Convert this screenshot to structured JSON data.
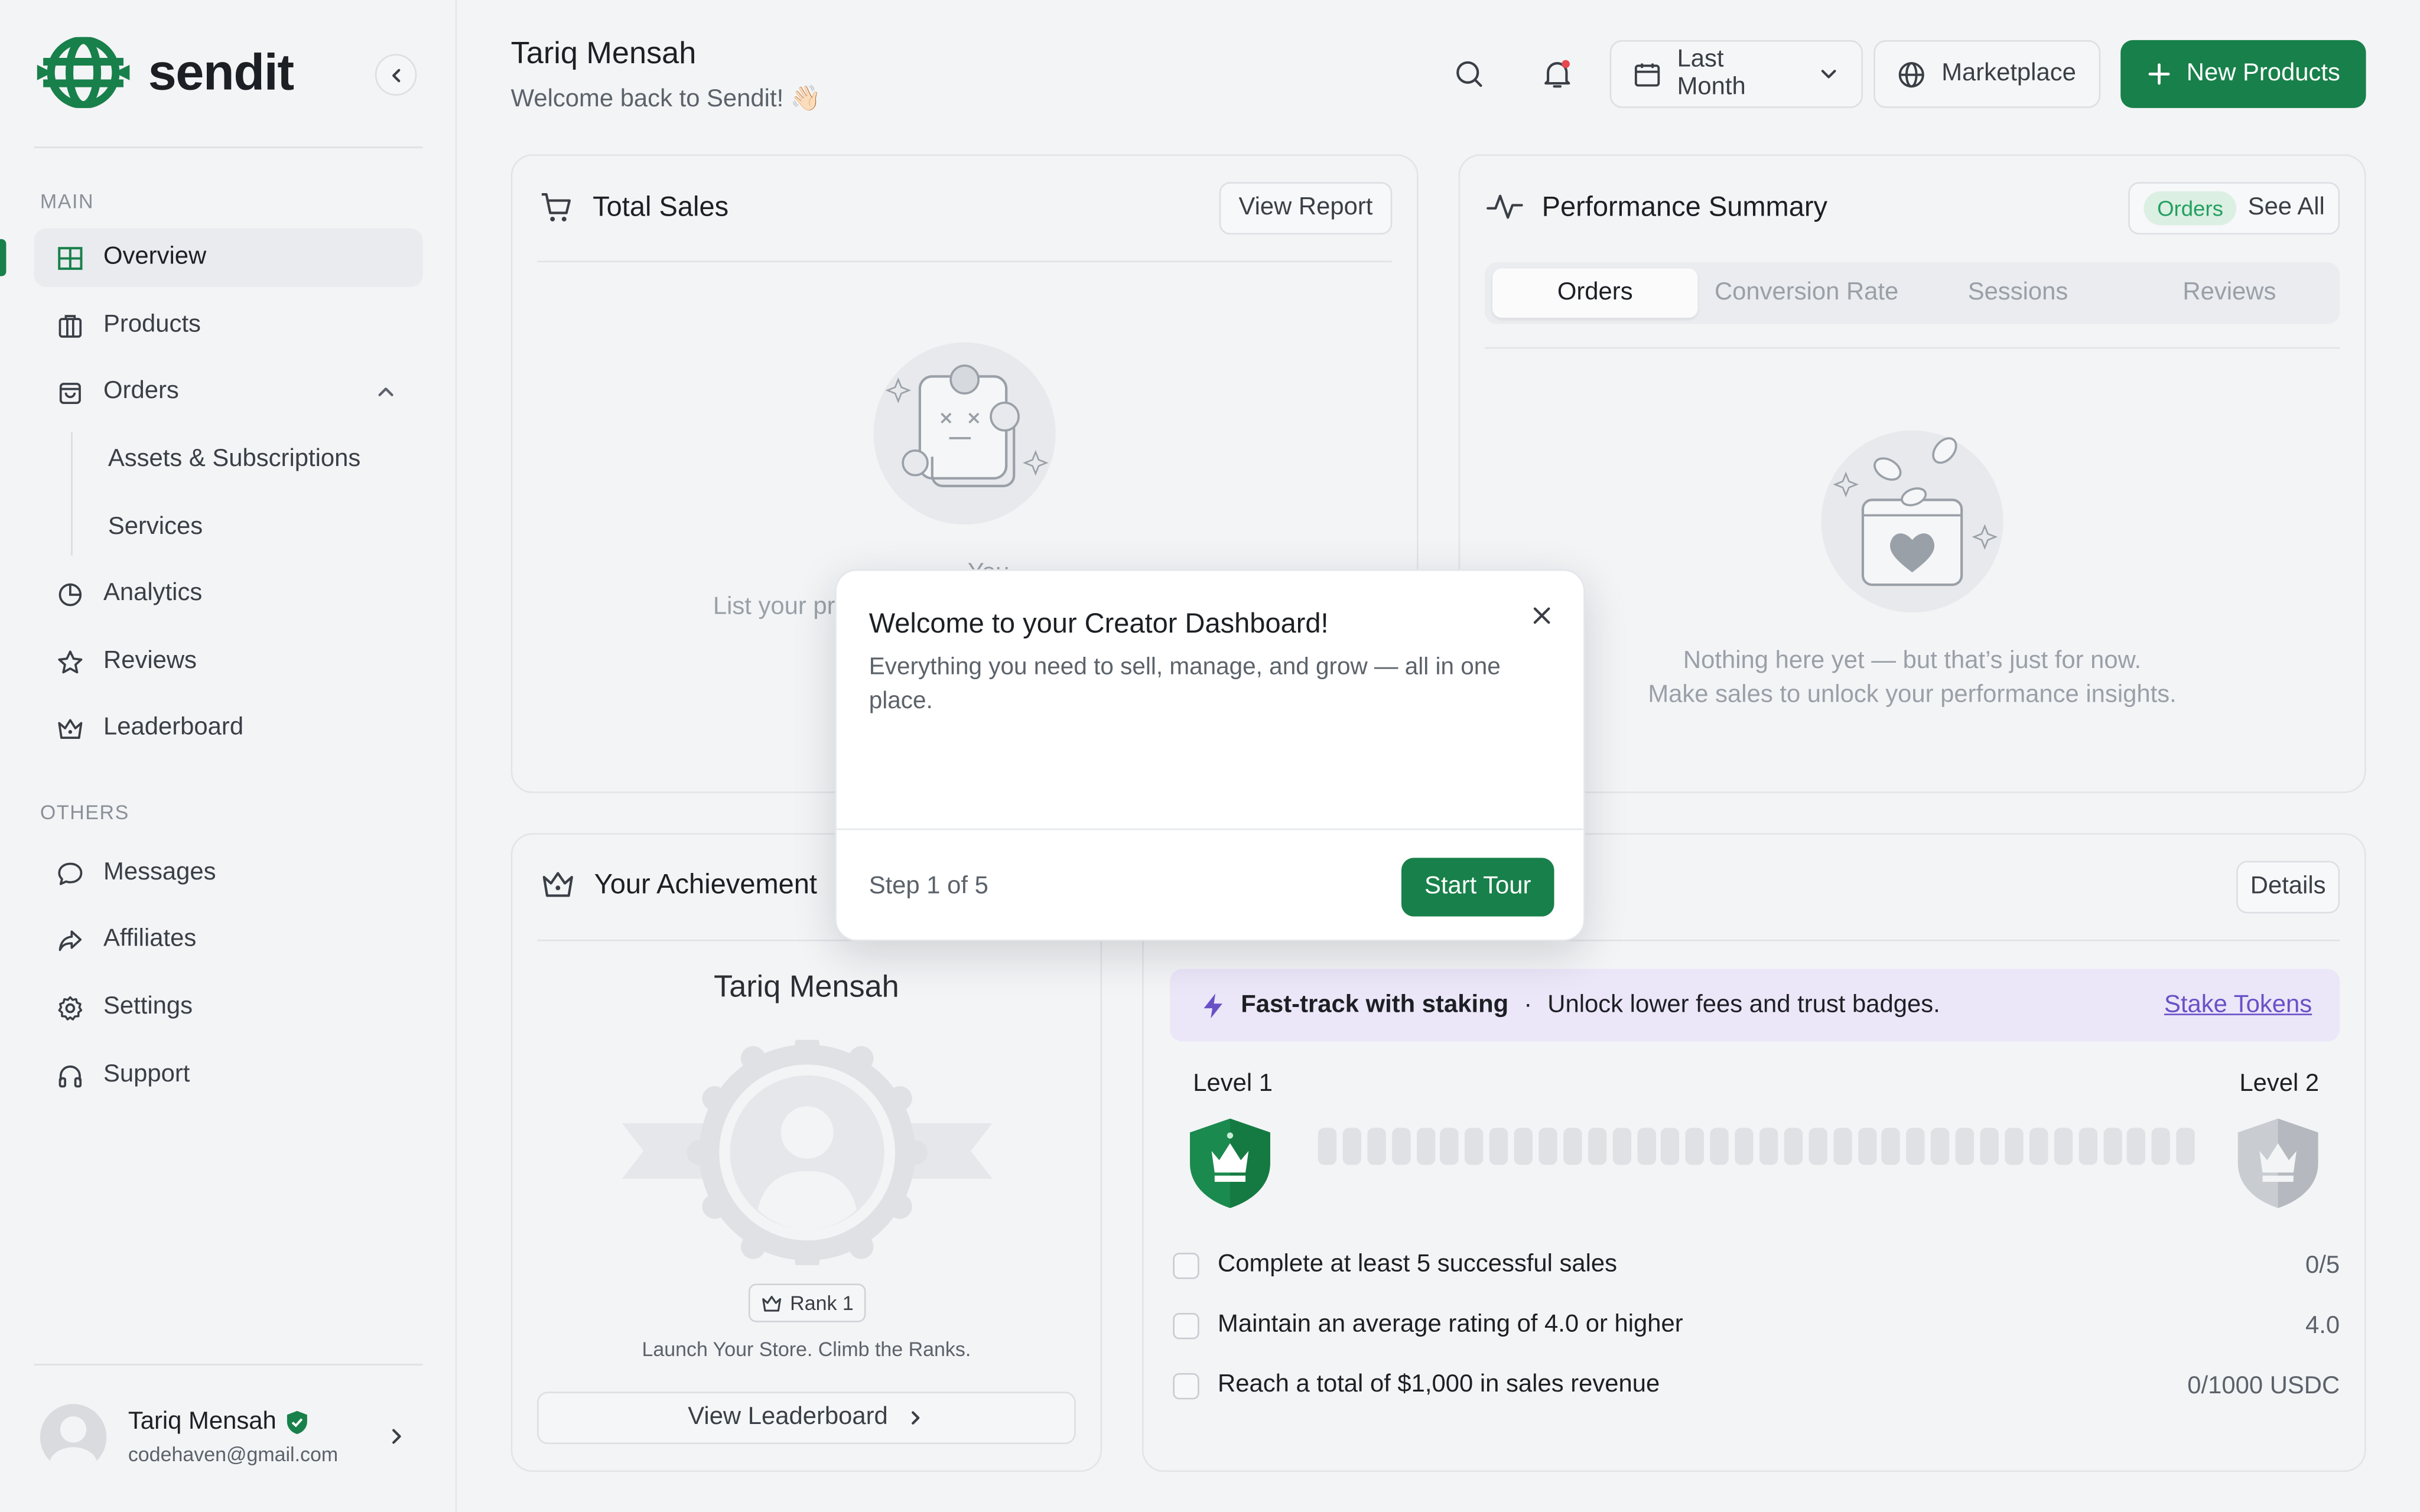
{
  "brand": {
    "name": "sendit"
  },
  "colors": {
    "accent": "#18804a",
    "stake_bg": "#ebe6f8",
    "stake_link": "#6a50c7",
    "badge_green": "#23a061"
  },
  "sidebar": {
    "main_label": "MAIN",
    "others_label": "OTHERS",
    "items": [
      {
        "label": "Overview",
        "icon": "grid-icon",
        "active": true
      },
      {
        "label": "Products",
        "icon": "box-icon"
      },
      {
        "label": "Orders",
        "icon": "bag-icon",
        "expanded": true
      },
      {
        "label": "Analytics",
        "icon": "pie-chart-icon"
      },
      {
        "label": "Reviews",
        "icon": "star-icon"
      },
      {
        "label": "Leaderboard",
        "icon": "crown-icon"
      }
    ],
    "sub_items": [
      "Assets & Subscriptions",
      "Services"
    ],
    "other_items": [
      {
        "label": "Messages",
        "icon": "chat-icon"
      },
      {
        "label": "Affiliates",
        "icon": "share-icon"
      },
      {
        "label": "Settings",
        "icon": "gear-icon"
      },
      {
        "label": "Support",
        "icon": "headphones-icon"
      }
    ],
    "profile": {
      "name": "Tariq Mensah",
      "email": "codehaven@gmail.com"
    }
  },
  "header": {
    "name": "Tariq Mensah",
    "welcome": "Welcome back to Sendit! 👋🏻",
    "period": "Last Month",
    "marketplace": "Marketplace",
    "new_products": "New Products"
  },
  "total_sales": {
    "title": "Total Sales",
    "view_report": "View Report",
    "empty_line1": "You",
    "empty_line2": "List your pr"
  },
  "performance": {
    "title": "Performance Summary",
    "badge": "Orders",
    "see_all": "See All",
    "tabs": [
      "Orders",
      "Conversion Rate",
      "Sessions",
      "Reviews"
    ],
    "empty_line1": "Nothing here yet — but that’s just for now.",
    "empty_line2": "Make sales to unlock your performance insights."
  },
  "achievement": {
    "title": "Your Achievement",
    "name": "Tariq Mensah",
    "rank": "Rank 1",
    "tagline": "Launch Your Store. Climb the Ranks.",
    "leaderboard_btn": "View Leaderboard"
  },
  "levels": {
    "details": "Details",
    "stake_title": "Fast-track with staking",
    "stake_sep": "·",
    "stake_desc": "Unlock lower fees and trust badges.",
    "stake_link": "Stake Tokens",
    "level_from": "Level 1",
    "level_to": "Level 2",
    "progress_segments_filled": 0,
    "tasks": [
      {
        "label": "Complete at least 5 successful sales",
        "value": "0/5"
      },
      {
        "label": "Maintain an average rating of 4.0 or higher",
        "value": "4.0"
      },
      {
        "label": "Reach a total of $1,000 in sales revenue",
        "value": "0/1000 USDC"
      }
    ]
  },
  "modal": {
    "title": "Welcome to your Creator Dashboard!",
    "body": "Everything you need to sell, manage, and grow — all in one place.",
    "step": "Step 1 of 5",
    "cta": "Start Tour"
  }
}
